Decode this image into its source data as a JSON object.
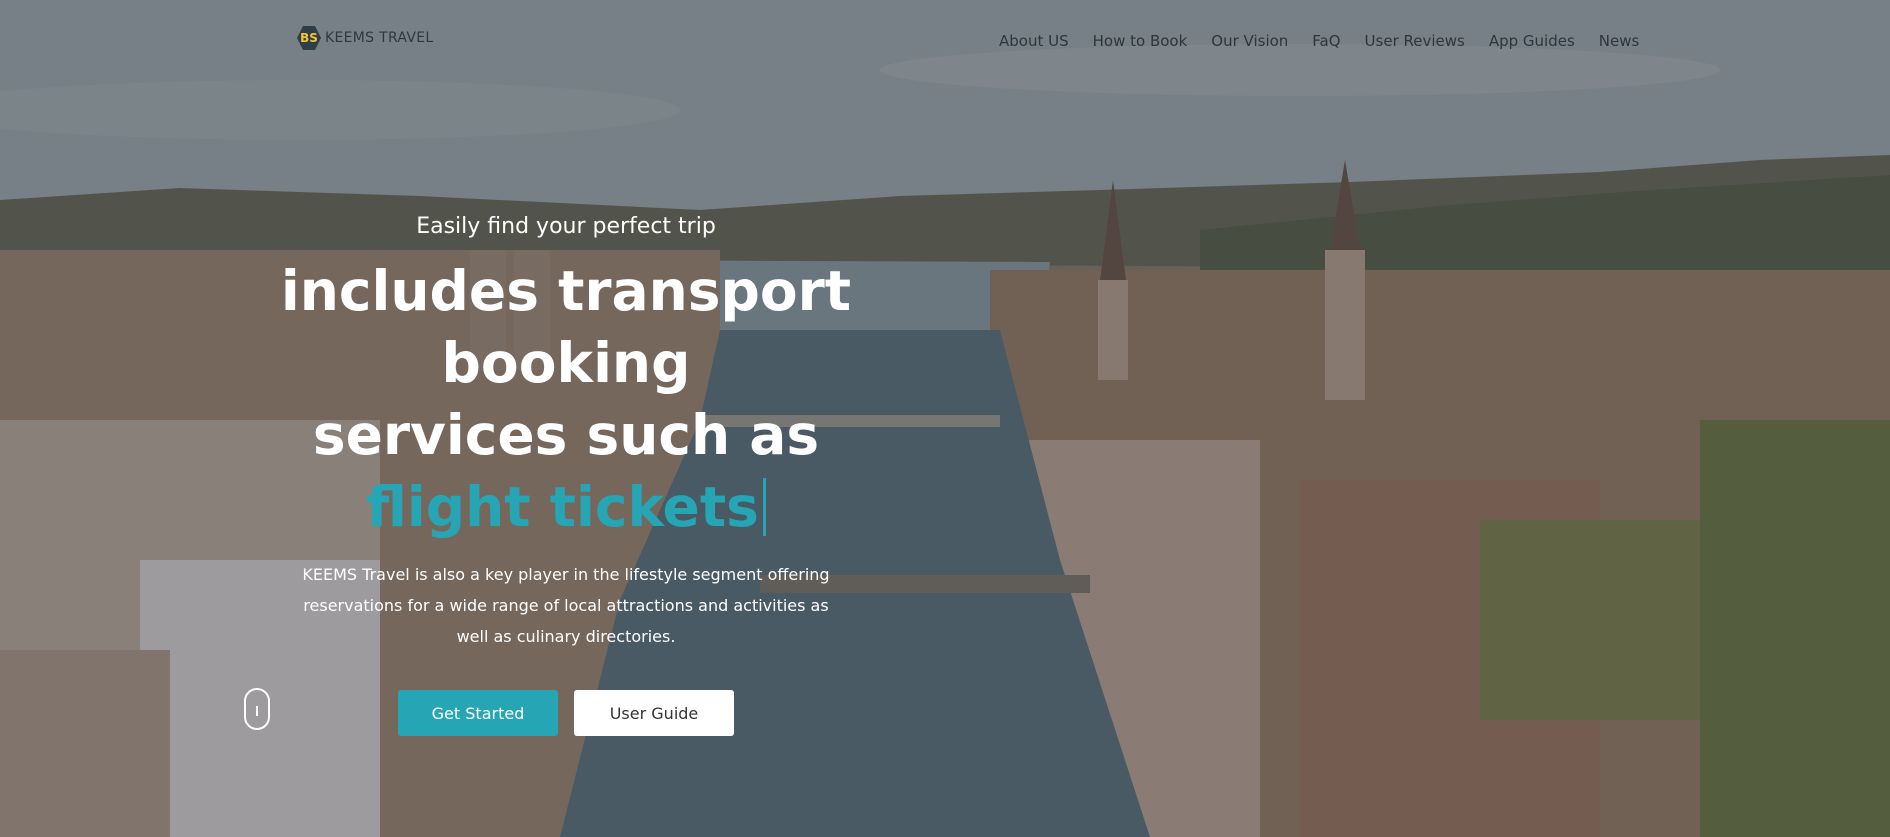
{
  "brand": {
    "mark": "BS",
    "name": "KEEMS TRAVEL"
  },
  "nav": [
    "About US",
    "How to Book",
    "Our Vision",
    "FaQ",
    "User Reviews",
    "App Guides",
    "News"
  ],
  "hero": {
    "kicker": "Easily find your perfect trip",
    "headline_line1": "includes transport booking",
    "headline_line2": "services such as",
    "typed_text": "flight tickets",
    "description": "KEEMS Travel is also a key player in the lifestyle segment offering reservations for a wide range of local attractions and activities as well as culinary directories.",
    "primary_button": "Get Started",
    "secondary_button": "User Guide"
  },
  "icons": {
    "scroll": "mouse-scroll-icon"
  },
  "colors": {
    "accent": "#26a6b4",
    "logo_yellow": "#f5c531"
  }
}
